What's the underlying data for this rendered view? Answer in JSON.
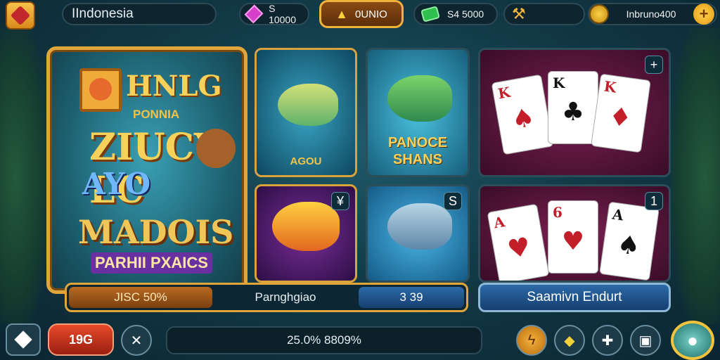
{
  "top_bar": {
    "region": "IIndonesia",
    "gems": "S 10000",
    "gold_label": "0UNIO",
    "cash": "S4 5000",
    "currency": "Inbruno400",
    "plus": "+"
  },
  "promo": {
    "line1": "HNLG",
    "line2": "PONNIA",
    "line3": "ZIUCY",
    "line3b": "LC",
    "line4": "AYO",
    "line5": "MADOIS",
    "line6": "PARHII PXAICS"
  },
  "tiles": {
    "fish1_label": "AGOU",
    "fish2_label": "PANOCE SHANS",
    "fish3_badge": "¥",
    "fish4_badge": "S",
    "cards1_badge": "+",
    "cards2_badge": "1"
  },
  "cards1": [
    {
      "rank": "K",
      "suit": "♠",
      "color": "red"
    },
    {
      "rank": "K",
      "suit": "♣",
      "color": "black"
    },
    {
      "rank": "K",
      "suit": "♦",
      "color": "red"
    }
  ],
  "cards2": [
    {
      "rank": "A",
      "suit": "♥",
      "color": "red"
    },
    {
      "rank": "6",
      "suit": "♥",
      "color": "red"
    },
    {
      "rank": "A",
      "suit": "♠",
      "color": "black"
    }
  ],
  "info_bar": {
    "segment_a": "JISC 50%",
    "segment_b": "Parnghgiao",
    "segment_c": "3 39"
  },
  "name_bar": "Saamivn Endurt",
  "bottom_bar": {
    "red_button": "19G",
    "message": "25.0% 8809%",
    "icons": [
      "back-icon",
      "settings-icon",
      "bolt-icon",
      "ticket-icon",
      "puzzle-icon",
      "lock-icon",
      "profile-icon"
    ]
  },
  "colors": {
    "gold": "#e0a63a",
    "teal_bg": "#1f5a6a",
    "red_button": "#e84a2a",
    "blue_button": "#2b6aa8"
  }
}
